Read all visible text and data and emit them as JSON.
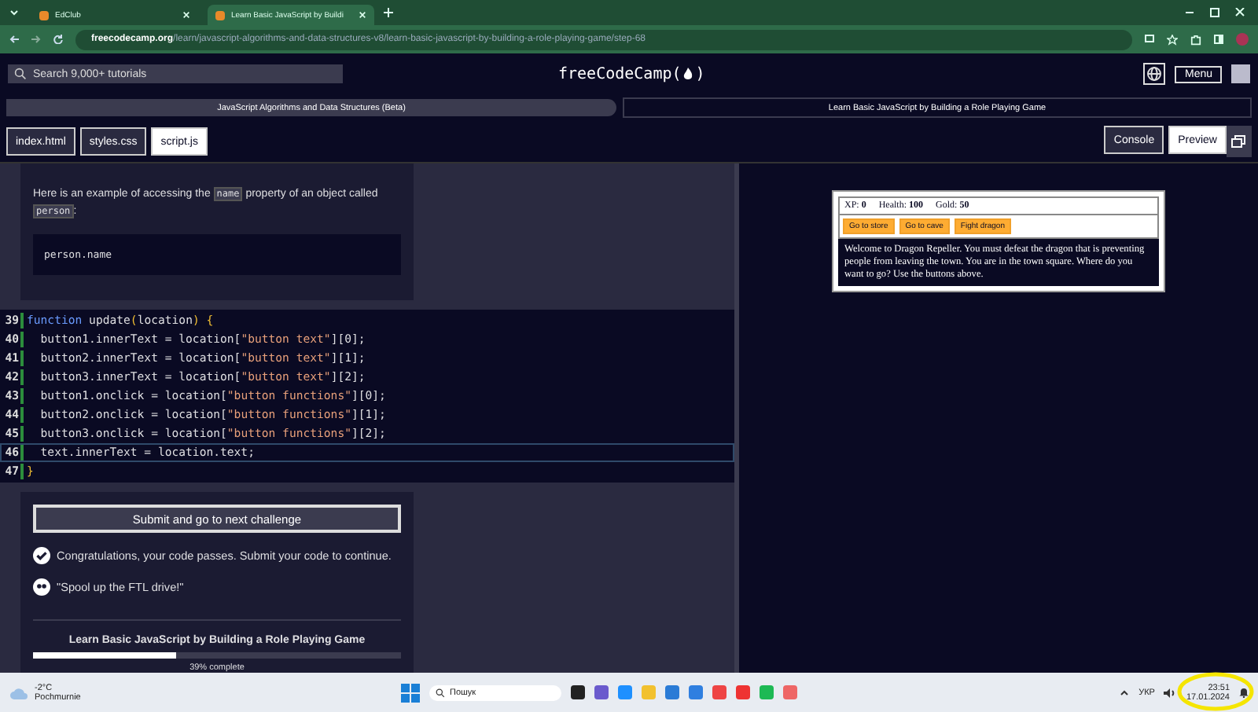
{
  "browser": {
    "tabs": [
      {
        "title": "EdClub",
        "selected": false
      },
      {
        "title": "Learn Basic JavaScript by Buildi",
        "selected": true
      }
    ],
    "url_host": "freecodecamp.org",
    "url_path": "/learn/javascript-algorithms-and-data-structures-v8/learn-basic-javascript-by-building-a-role-playing-game/step-68"
  },
  "nav": {
    "search_placeholder": "Search 9,000+ tutorials",
    "logo_text": "freeCodeCamp(",
    "logo_end": ")",
    "menu": "Menu"
  },
  "breadcrumbs": [
    "JavaScript Algorithms and Data Structures (Beta)",
    "Learn Basic JavaScript by Building a Role Playing Game"
  ],
  "file_tabs": [
    {
      "label": "index.html",
      "selected": false
    },
    {
      "label": "styles.css",
      "selected": false
    },
    {
      "label": "script.js",
      "selected": true
    }
  ],
  "view_buttons": [
    {
      "label": "Console",
      "selected": false
    },
    {
      "label": "Preview",
      "selected": true
    }
  ],
  "instructions": {
    "paragraph_parts": [
      "Here is an example of accessing the ",
      "name",
      " property of an object called ",
      "person",
      ":"
    ],
    "example": "person.name"
  },
  "code": [
    {
      "num": "39",
      "active": false,
      "tokens": [
        {
          "kind": "keyword",
          "text": "function"
        },
        {
          "kind": "plain",
          "text": " update"
        },
        {
          "kind": "bracket",
          "text": "("
        },
        {
          "kind": "plain",
          "text": "location"
        },
        {
          "kind": "bracket",
          "text": ")"
        },
        {
          "kind": "bracket",
          "text": " {"
        }
      ]
    },
    {
      "num": "40",
      "active": false,
      "tokens": [
        {
          "kind": "plain",
          "text": "  button1.innerText = location["
        },
        {
          "kind": "string",
          "text": "\"button text\""
        },
        {
          "kind": "plain",
          "text": "][0];"
        }
      ]
    },
    {
      "num": "41",
      "active": false,
      "tokens": [
        {
          "kind": "plain",
          "text": "  button2.innerText = location["
        },
        {
          "kind": "string",
          "text": "\"button text\""
        },
        {
          "kind": "plain",
          "text": "][1];"
        }
      ]
    },
    {
      "num": "42",
      "active": false,
      "tokens": [
        {
          "kind": "plain",
          "text": "  button3.innerText = location["
        },
        {
          "kind": "string",
          "text": "\"button text\""
        },
        {
          "kind": "plain",
          "text": "][2];"
        }
      ]
    },
    {
      "num": "43",
      "active": false,
      "tokens": [
        {
          "kind": "plain",
          "text": "  button1.onclick = location["
        },
        {
          "kind": "string",
          "text": "\"button functions\""
        },
        {
          "kind": "plain",
          "text": "][0];"
        }
      ]
    },
    {
      "num": "44",
      "active": false,
      "tokens": [
        {
          "kind": "plain",
          "text": "  button2.onclick = location["
        },
        {
          "kind": "string",
          "text": "\"button functions\""
        },
        {
          "kind": "plain",
          "text": "][1];"
        }
      ]
    },
    {
      "num": "45",
      "active": false,
      "tokens": [
        {
          "kind": "plain",
          "text": "  button3.onclick = location["
        },
        {
          "kind": "string",
          "text": "\"button functions\""
        },
        {
          "kind": "plain",
          "text": "][2];"
        }
      ]
    },
    {
      "num": "46",
      "active": true,
      "tokens": [
        {
          "kind": "plain",
          "text": "  text.innerText = location.text;"
        }
      ]
    },
    {
      "num": "47",
      "active": false,
      "tokens": [
        {
          "kind": "bracket",
          "text": "}"
        }
      ]
    }
  ],
  "result": {
    "submit": "Submit and go to next challenge",
    "passed": "Congratulations, your code passes. Submit your code to continue.",
    "quote": "\"Spool up the FTL drive!\"",
    "course": "Learn Basic JavaScript by Building a Role Playing Game",
    "level": 0.39,
    "percent": "39% complete"
  },
  "game": {
    "stats": [
      {
        "label": "XP:",
        "value": "0"
      },
      {
        "label": "Health:",
        "value": "100"
      },
      {
        "label": "Gold:",
        "value": "50"
      }
    ],
    "buttons": [
      "Go to store",
      "Go to cave",
      "Fight dragon"
    ],
    "text": "Welcome to Dragon Repeller. You must defeat the dragon that is preventing people from leaving the town. You are in the town square. Where do you want to go? Use the buttons above."
  },
  "taskbar": {
    "temperature": "-2°C",
    "weather": "Pochmurnie",
    "search_placeholder": "Пошук",
    "language": "УКР",
    "time": "23:51",
    "date": "17.01.2024"
  }
}
